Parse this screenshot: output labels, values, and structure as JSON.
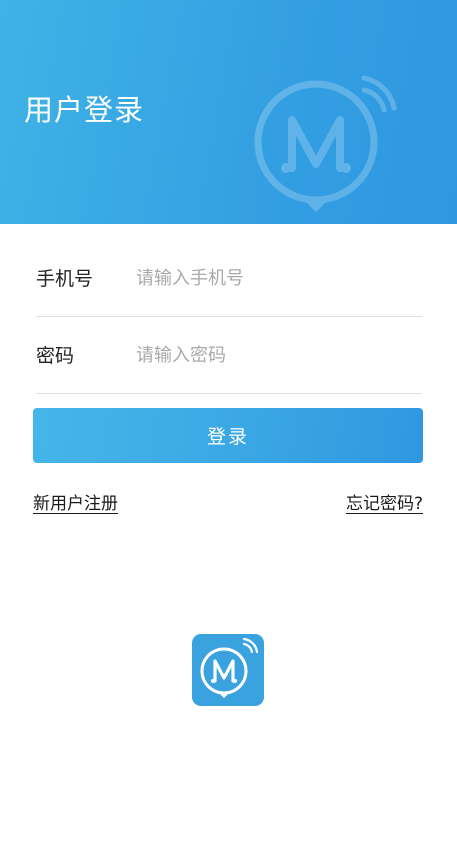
{
  "header": {
    "title": "用户登录",
    "watermark_icon": "m-logo-icon",
    "gradient_start": "#3fb3e6",
    "gradient_end": "#2f97e0"
  },
  "form": {
    "phone": {
      "label": "手机号",
      "placeholder": "请输入手机号",
      "value": ""
    },
    "password": {
      "label": "密码",
      "placeholder": "请输入密码",
      "value": ""
    },
    "login_button_label": "登录"
  },
  "links": {
    "register": "新用户注册",
    "forgot_password": "忘记密码?"
  },
  "footer_logo": {
    "icon": "app-logo-icon",
    "background": "#3aa3df"
  }
}
